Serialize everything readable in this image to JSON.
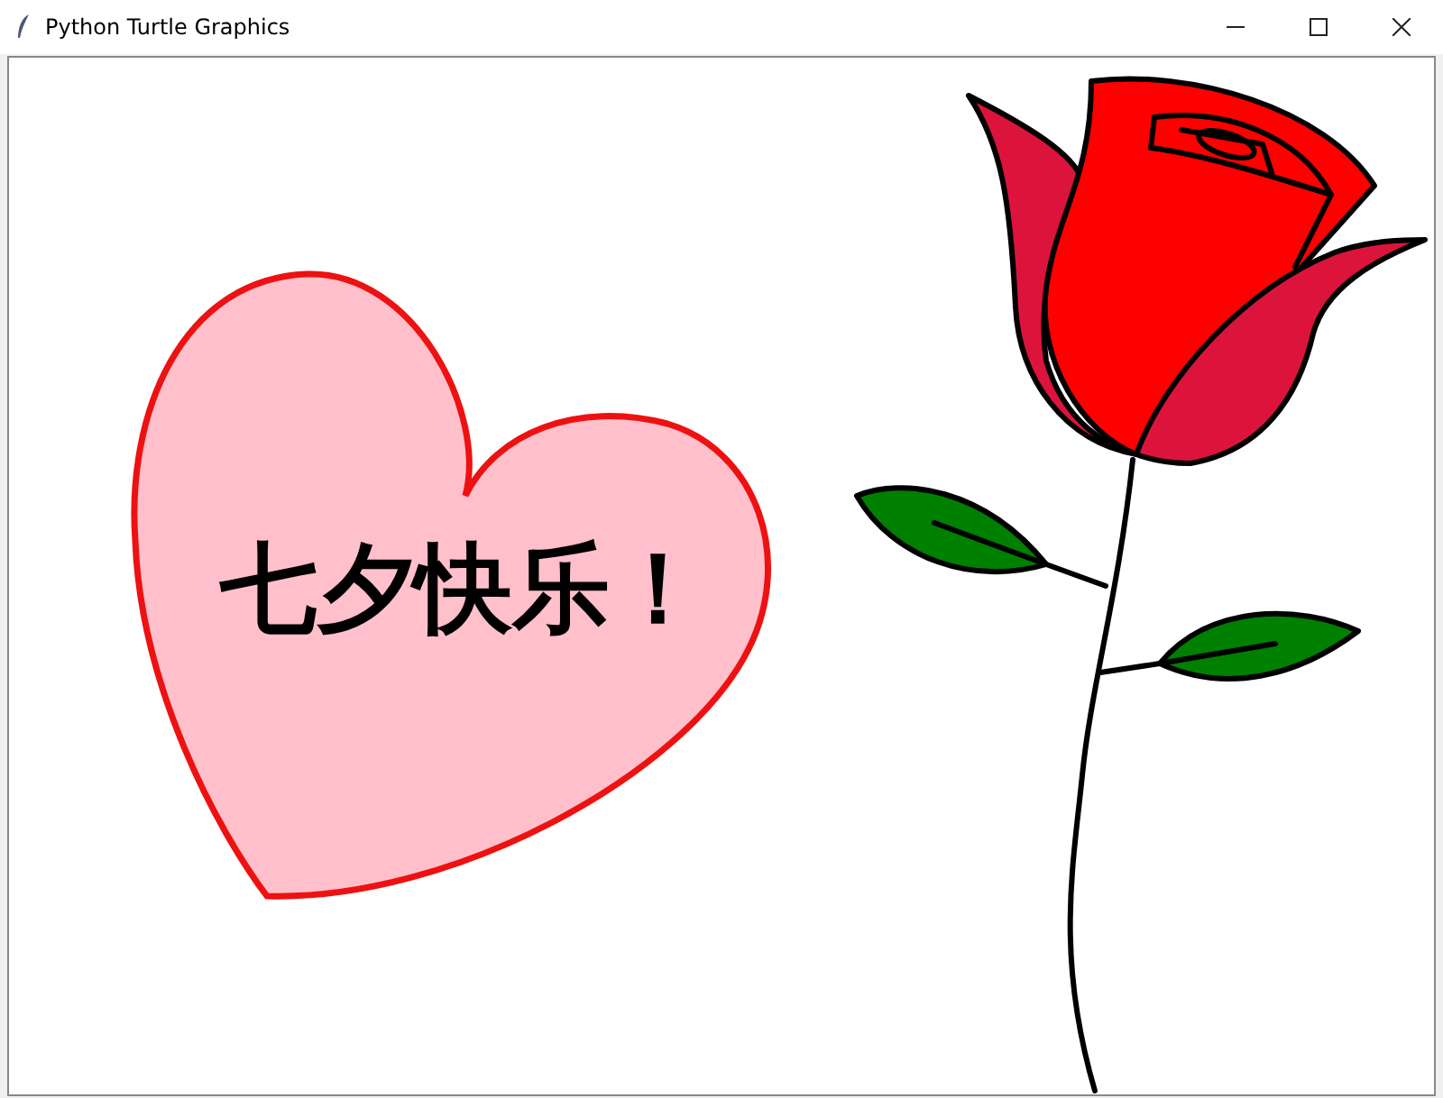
{
  "window": {
    "title": "Python Turtle Graphics"
  },
  "canvas": {
    "heart_text": "七夕快乐！"
  }
}
